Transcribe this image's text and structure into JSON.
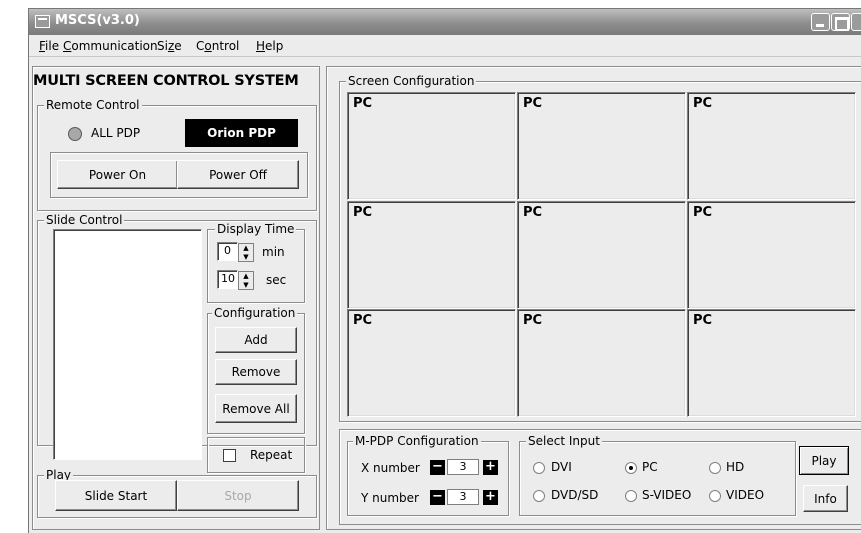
{
  "window": {
    "title": "MSCS(v3.0)"
  },
  "menu": [
    {
      "label": "File",
      "key": "F"
    },
    {
      "label": "Communication",
      "key": "C"
    },
    {
      "label": "Size",
      "key": "z"
    },
    {
      "label": "Control",
      "key": "o"
    },
    {
      "label": "Help",
      "key": "H"
    }
  ],
  "left": {
    "heading": "MULTI SCREEN CONTROL SYSTEM",
    "remote": {
      "legend": "Remote Control",
      "all_pdp": "ALL PDP",
      "device_name": "Orion PDP",
      "power_on": "Power On",
      "power_off": "Power Off"
    },
    "slide": {
      "legend": "Slide Control",
      "display_time_legend": "Display Time",
      "min_value": "0",
      "min_unit": "min",
      "sec_value": "10",
      "sec_unit": "sec",
      "config_legend": "Configuration",
      "add": "Add",
      "remove": "Remove",
      "remove_all": "Remove All",
      "repeat": "Repeat"
    },
    "play": {
      "legend": "Play",
      "start": "Slide Start",
      "stop": "Stop"
    }
  },
  "screen_config": {
    "legend": "Screen Configuration",
    "cells": [
      "PC",
      "PC",
      "PC",
      "PC",
      "PC",
      "PC",
      "PC",
      "PC",
      "PC"
    ]
  },
  "mpdp": {
    "legend": "M-PDP Configuration",
    "x_label": "X number",
    "x_value": "3",
    "y_label": "Y number",
    "y_value": "3"
  },
  "input": {
    "legend": "Select Input",
    "options": [
      {
        "label": "DVI",
        "checked": false
      },
      {
        "label": "PC",
        "checked": true
      },
      {
        "label": "HD",
        "checked": false
      },
      {
        "label": "DVD/SD",
        "checked": false
      },
      {
        "label": "S-VIDEO",
        "checked": false
      },
      {
        "label": "VIDEO",
        "checked": false
      }
    ]
  },
  "actions": {
    "play": "Play",
    "info": "Info"
  }
}
